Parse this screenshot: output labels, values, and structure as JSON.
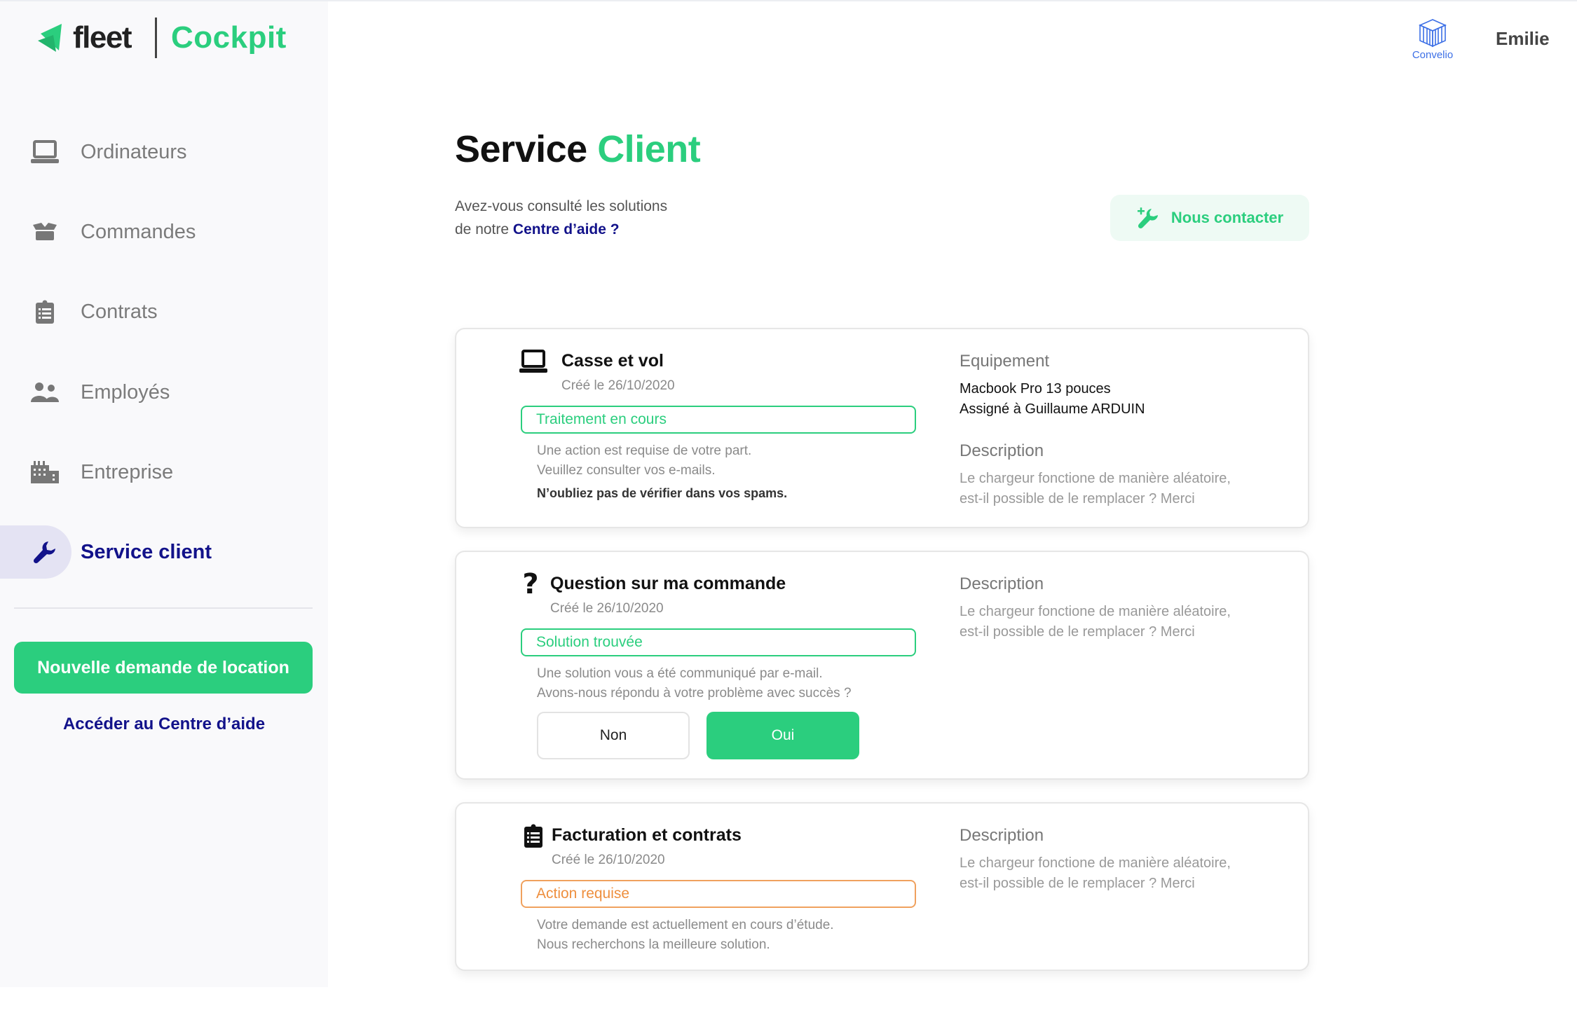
{
  "brand": {
    "name": "fleet",
    "product": "Cockpit",
    "colors": {
      "green": "#2bce7e",
      "navy": "#12128a",
      "orange": "#ee8f3e"
    }
  },
  "header": {
    "company": "Convelio",
    "user": "Emilie"
  },
  "sidebar": {
    "items": [
      {
        "label": "Ordinateurs",
        "icon": "laptop-icon",
        "active": false
      },
      {
        "label": "Commandes",
        "icon": "box-icon",
        "active": false
      },
      {
        "label": "Contrats",
        "icon": "clipboard-icon",
        "active": false
      },
      {
        "label": "Employés",
        "icon": "users-icon",
        "active": false
      },
      {
        "label": "Entreprise",
        "icon": "building-icon",
        "active": false
      },
      {
        "label": "Service client",
        "icon": "wrench-icon",
        "active": true
      }
    ],
    "new_request_button": "Nouvelle demande de location",
    "help_link": "Accéder au Centre d’aide"
  },
  "main": {
    "title_part1": "Service",
    "title_part2": "Client",
    "intro_line1": "Avez-vous consulté les solutions",
    "intro_line2_prefix": "de notre",
    "intro_link": "Centre d’aide ?",
    "contact_button": "Nous contacter",
    "tickets": [
      {
        "category": "Casse et vol",
        "icon": "laptop-icon",
        "created": "Créé le 26/10/2020",
        "status": "Traitement en cours",
        "status_color": "green",
        "message_lines": [
          "Une action est requise de votre part.",
          "Veuillez consulter vos e-mails."
        ],
        "message_note": "N’oubliez pas de vérifier dans vos spams.",
        "equipment_label": "Equipement",
        "equipment_lines": [
          "Macbook Pro 13 pouces",
          "Assigné à Guillaume ARDUIN"
        ],
        "description_label": "Description",
        "description_lines": [
          "Le chargeur fonctione de manière aléatoire,",
          "est-il possible de le remplacer ? Merci"
        ]
      },
      {
        "category": "Question sur ma commande",
        "icon": "question-icon",
        "created": "Créé le 26/10/2020",
        "status": "Solution trouvée",
        "status_color": "green",
        "message_lines": [
          "Une solution vous a été communiqué par e-mail.",
          "Avons-nous répondu à votre problème avec succès ?"
        ],
        "no_button": "Non",
        "yes_button": "Oui",
        "description_label": "Description",
        "description_lines": [
          "Le chargeur fonctione de manière aléatoire,",
          "est-il possible de le remplacer ? Merci"
        ]
      },
      {
        "category": "Facturation et contrats",
        "icon": "clipboard-icon",
        "created": "Créé le 26/10/2020",
        "status": "Action requise",
        "status_color": "orange",
        "message_lines": [
          "Votre demande est actuellement en cours d’étude.",
          "Nous recherchons la meilleure solution."
        ],
        "description_label": "Description",
        "description_lines": [
          "Le chargeur fonctione de manière aléatoire,",
          "est-il possible de le remplacer ? Merci"
        ]
      }
    ]
  }
}
